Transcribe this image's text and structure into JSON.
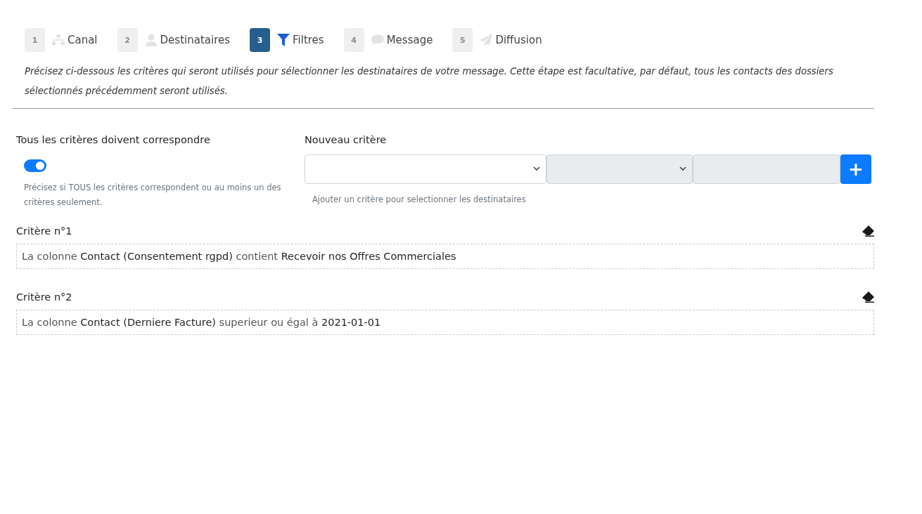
{
  "steps": [
    {
      "number": "1",
      "label": "Canal",
      "selected": false
    },
    {
      "number": "2",
      "label": "Destinataires",
      "selected": false
    },
    {
      "number": "3",
      "label": "Filtres",
      "selected": true
    },
    {
      "number": "4",
      "label": "Message",
      "selected": false
    },
    {
      "number": "5",
      "label": "Diffusion",
      "selected": false
    }
  ],
  "intro": "Précisez ci-dessous les critères qui seront utilisés pour sélectionner les destinataires de votre message. Cette étape est facultative, par défaut, tous les contacts des dossiers sélectionnés précédemment seront utilisés.",
  "match_all": {
    "label": "Tous les critères doivent correspondre",
    "on": true,
    "help": "Précisez si TOUS les critères correspondent ou au moins un des critères seulement."
  },
  "new_criterion": {
    "label": "Nouveau critère",
    "help": "Ajouter un critère pour selectionner les destinataires",
    "add_button": "+"
  },
  "criteria": [
    {
      "title": "Critère n°1",
      "prefix": "La colonne",
      "column": "Contact (Consentement rgpd)",
      "operator": "contient",
      "value": "Recevoir nos Offres Commerciales"
    },
    {
      "title": "Critère n°2",
      "prefix": "La colonne",
      "column": "Contact (Derniere Facture)",
      "operator": "superieur ou égal à",
      "value": "2021-01-01"
    }
  ]
}
